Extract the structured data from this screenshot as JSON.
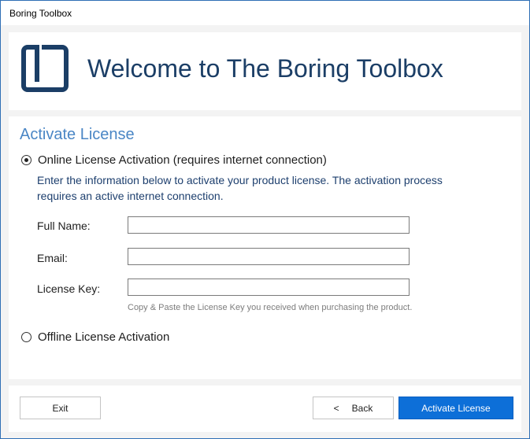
{
  "window": {
    "title": "Boring Toolbox"
  },
  "header": {
    "welcome_text": "Welcome to The Boring Toolbox",
    "logo_icon": "boring-toolbox-logo-icon",
    "logo_color": "#1b3e66"
  },
  "main": {
    "section_title": "Activate License",
    "online_option": {
      "label": "Online License Activation (requires internet connection)",
      "selected": true
    },
    "description_line1": "Enter the information below to activate your product license. The activation process",
    "description_line2": "requires an active internet connection.",
    "fields": {
      "full_name": {
        "label": "Full Name:",
        "value": ""
      },
      "email": {
        "label": "Email:",
        "value": ""
      },
      "license_key": {
        "label": "License Key:",
        "value": ""
      }
    },
    "license_hint": "Copy & Paste the License Key you received when purchasing the product.",
    "offline_option": {
      "label": "Offline License Activation",
      "selected": false
    }
  },
  "footer": {
    "exit_label": "Exit",
    "back_arrow": "<",
    "back_label": "Back",
    "activate_label": "Activate License"
  },
  "colors": {
    "accent": "#0d6fd8",
    "heading_blue": "#4a86c5",
    "title_navy": "#1b3e66"
  }
}
